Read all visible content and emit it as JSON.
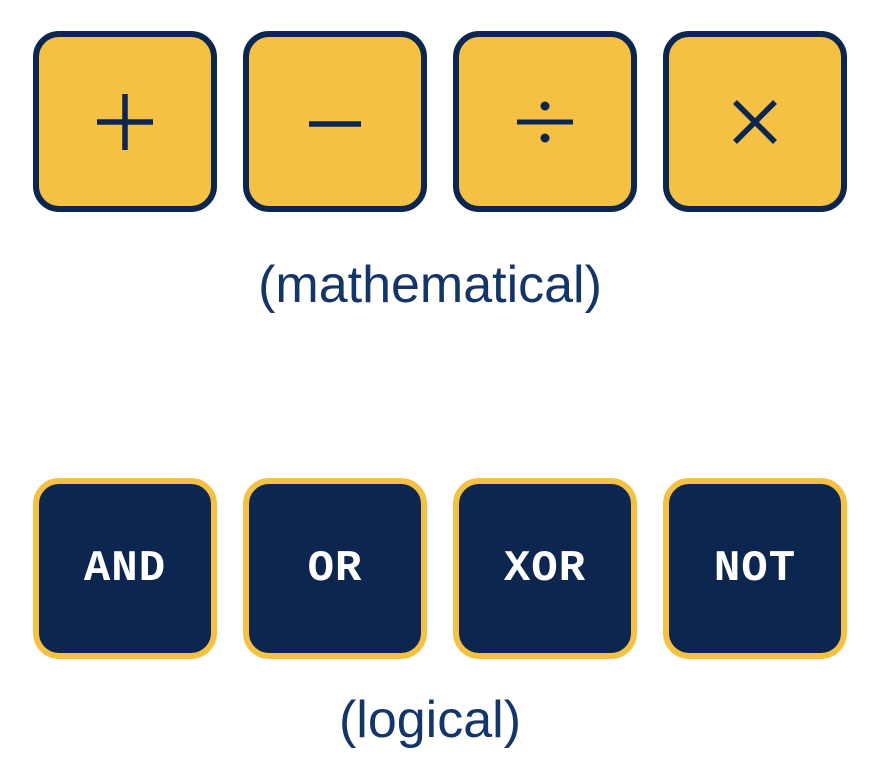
{
  "colors": {
    "gold": "#f4c144",
    "navy": "#0c2650",
    "caption": "#14356a",
    "logic_text": "#ffffff"
  },
  "math_operators": [
    {
      "icon": "plus-icon"
    },
    {
      "icon": "minus-icon"
    },
    {
      "icon": "divide-icon"
    },
    {
      "icon": "multiply-icon"
    }
  ],
  "math_caption": "(mathematical)",
  "logic_operators": [
    {
      "label": "AND"
    },
    {
      "label": "OR"
    },
    {
      "label": "XOR"
    },
    {
      "label": "NOT"
    }
  ],
  "logic_caption": "(logical)"
}
